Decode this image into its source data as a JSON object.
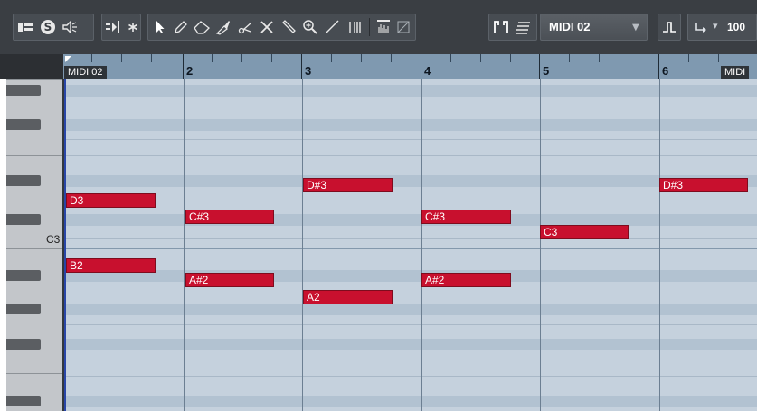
{
  "toolbar": {
    "track_name": "MIDI 02",
    "velocity": "100"
  },
  "ruler": {
    "part_label": "MIDI 02",
    "part_label_right": "MIDI",
    "bars": [
      "2",
      "3",
      "4",
      "5",
      "6"
    ]
  },
  "keyboard": {
    "c3_label": "C3"
  },
  "notes": [
    {
      "label": "D3"
    },
    {
      "label": "B2"
    },
    {
      "label": "C#3"
    },
    {
      "label": "A#2"
    },
    {
      "label": "D#3"
    },
    {
      "label": "A2"
    },
    {
      "label": "C#3"
    },
    {
      "label": "A#2"
    },
    {
      "label": "C3"
    },
    {
      "label": "D#3"
    }
  ],
  "colors": {
    "note": "#c8102e",
    "grid": "#c5d1dd",
    "ruler": "#7f99b0",
    "toolbar": "#3a3e43"
  }
}
